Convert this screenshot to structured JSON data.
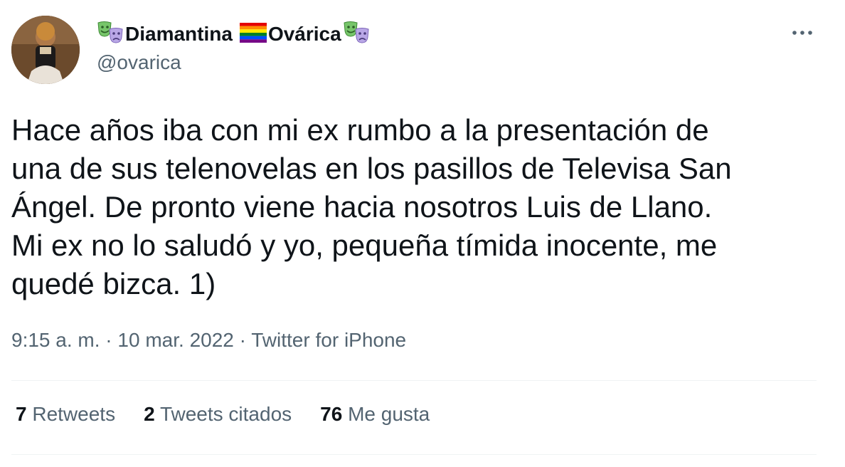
{
  "author": {
    "display_name_part1": "Diamantina",
    "display_name_part2": "Ovárica",
    "handle": "@ovarica",
    "name_emojis": [
      "theater-masks-icon",
      "rainbow-flag-icon",
      "theater-masks-icon"
    ]
  },
  "tweet": {
    "text": "Hace años iba con mi ex rumbo a la presentación de\nuna de sus telenovelas en los pasillos de Televisa San\nÁngel. De pronto viene hacia nosotros Luis de Llano.\nMi ex no lo saludó y yo, pequeña tímida inocente, me\nquedé bizca. 1)",
    "time": "9:15 a. m.",
    "separator": "·",
    "date": "10 mar. 2022",
    "source": "Twitter for iPhone"
  },
  "stats": {
    "retweets_count": "7",
    "retweets_label": "Retweets",
    "quotes_count": "2",
    "quotes_label": "Tweets citados",
    "likes_count": "76",
    "likes_label": "Me gusta"
  },
  "colors": {
    "text_primary": "#0f1419",
    "text_secondary": "#536471",
    "divider": "#eff3f4"
  },
  "icons": {
    "more": "more-horizontal-icon"
  }
}
